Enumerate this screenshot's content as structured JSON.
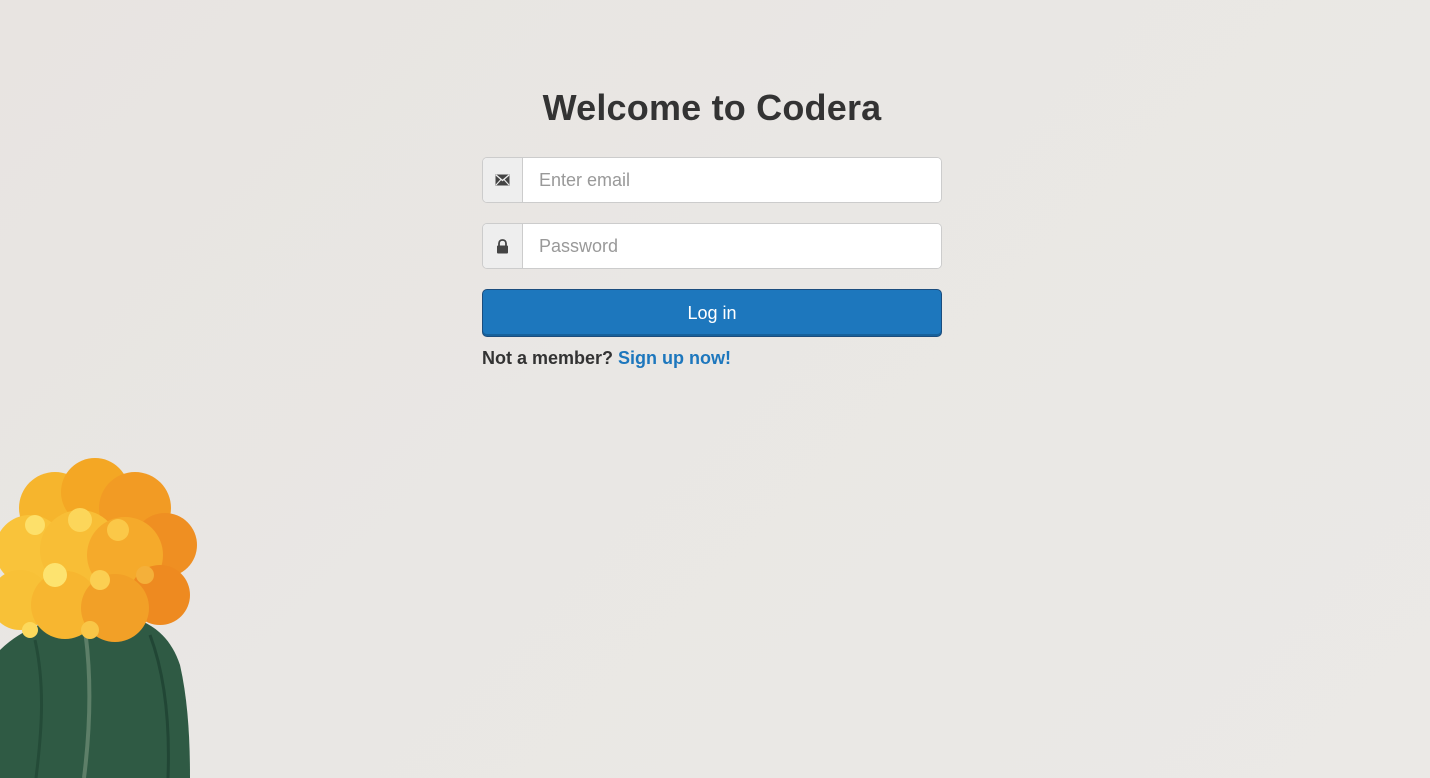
{
  "page": {
    "title": "Welcome to Codera"
  },
  "form": {
    "email": {
      "value": "",
      "placeholder": "Enter email",
      "icon": "envelope-icon"
    },
    "password": {
      "value": "",
      "placeholder": "Password",
      "icon": "lock-icon"
    },
    "login_label": "Log in",
    "signup_prompt": "Not a member?",
    "signup_link": "Sign up now!"
  },
  "colors": {
    "accent": "#1d77bd",
    "background": "#e9e7e4",
    "text": "#333333"
  }
}
